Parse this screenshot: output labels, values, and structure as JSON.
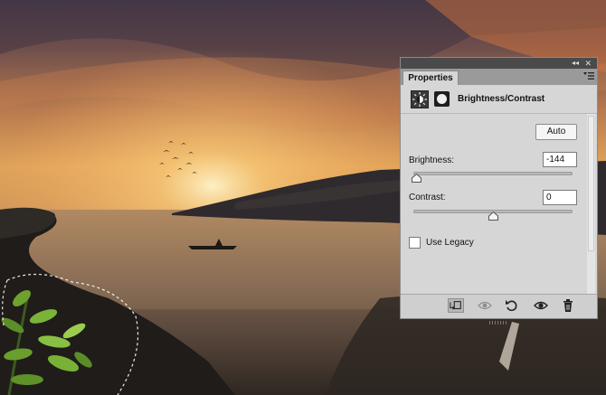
{
  "panel": {
    "tab_label": "Properties",
    "adjustment_title": "Brightness/Contrast",
    "auto_label": "Auto",
    "brightness": {
      "label": "Brightness:",
      "value": "-144",
      "slider_fraction": 0.02
    },
    "contrast": {
      "label": "Contrast:",
      "value": "0",
      "slider_fraction": 0.5
    },
    "legacy": {
      "label": "Use Legacy",
      "checked": false
    }
  },
  "icons": {
    "collapse": "double-chevron-right-icon",
    "close": "close-icon",
    "panel_menu": "panel-menu-icon",
    "adjustment": "brightness-adjustment-icon",
    "mask": "layer-mask-icon",
    "clip": "clip-to-layer-icon",
    "view_previous": "view-previous-state-icon",
    "reset": "reset-icon",
    "visibility": "visibility-eye-icon",
    "delete": "trash-icon"
  },
  "colors": {
    "panel_bg": "#d6d6d6",
    "panel_dark": "#4a4a4a",
    "tab_bar": "#9a9a9a"
  }
}
